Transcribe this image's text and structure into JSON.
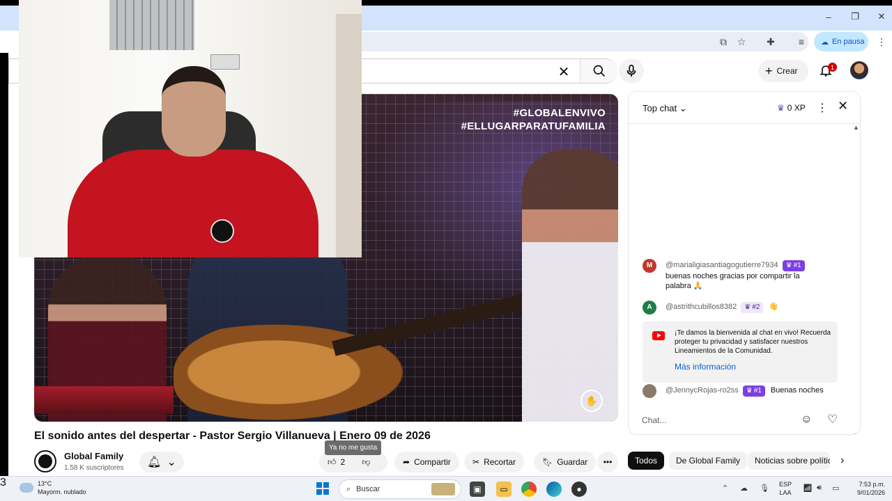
{
  "browser": {
    "window_controls": [
      "–",
      "❐",
      "✕"
    ],
    "profile_chip": "En pausa"
  },
  "youtube": {
    "header": {
      "create_label": "Crear",
      "notification_count": "1"
    },
    "video": {
      "hashtags": [
        "#GLOBALENVIVO",
        "#ELLUGARPARATUFAMILIA"
      ],
      "title": "El sonido antes del despertar - Pastor Sergio Villanueva | Enero 09 de 2026"
    },
    "channel": {
      "name": "Global Family",
      "subscribers": "1.58 K suscriptores"
    },
    "actions": {
      "like_count": "2",
      "dislike_tooltip": "Ya no me gusta",
      "share": "Compartir",
      "clip": "Recortar",
      "save": "Guardar",
      "more": "•••"
    },
    "chat": {
      "mode": "Top chat",
      "xp": "0 XP",
      "messages": [
        {
          "initial": "M",
          "avatar_color": "#c0392b",
          "author": "@marialigiasantiagogutierre7934",
          "rank": "#1",
          "rank_style": "purple",
          "text": "buenas noches gracias por compartir la palabra 🙏"
        },
        {
          "initial": "A",
          "avatar_color": "#1e7e4a",
          "author": "@astrithcubillos8382",
          "rank": "#2",
          "rank_style": "light",
          "text": "👋"
        },
        {
          "initial": "",
          "avatar_color": "#8a7a6a",
          "author": "@JennycRojas-ro2ss",
          "rank": "#1",
          "rank_style": "purple",
          "text": "Buenas noches"
        }
      ],
      "welcome": {
        "text": "¡Te damos la bienvenida al chat en vivo! Recuerda proteger tu privacidad y satisfacer nuestros Lineamientos de la Comunidad.",
        "link": "Más información"
      },
      "input_placeholder": "Chat..."
    },
    "filter_chips": [
      "Todos",
      "De Global Family",
      "Noticias sobre polític"
    ]
  },
  "taskbar": {
    "weather_temp": "13°C",
    "weather_desc": "Mayorm. nublado",
    "weather_badge": "3",
    "search_label": "Buscar",
    "lang_top": "ESP",
    "lang_bottom": "LAA",
    "time": "7:53 p.m.",
    "date": "9/01/2026"
  },
  "colors": {
    "accent_blue": "#065fd4",
    "rank_purple": "#7b3fe4",
    "youtube_red": "#ff0000"
  }
}
